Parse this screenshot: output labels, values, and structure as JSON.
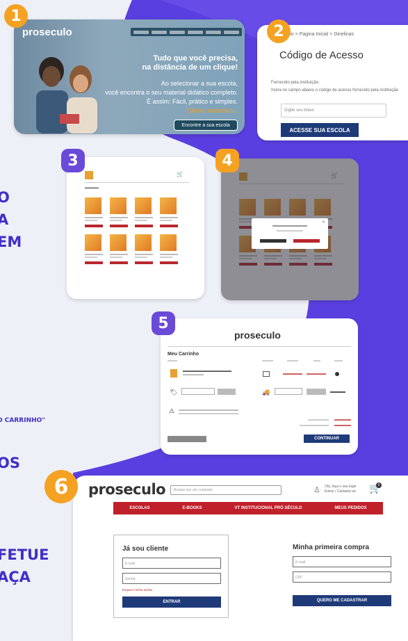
{
  "colors": {
    "purple": "#5a3fe0",
    "orange": "#f5a122",
    "navy": "#1e3a78",
    "red": "#c0202a"
  },
  "badges": [
    "1",
    "2",
    "3",
    "4",
    "5",
    "6"
  ],
  "left_text": {
    "l1": "O",
    "l2": "A",
    "l3": "EM",
    "l4": "O CARRINHO\"",
    "l5": "OS",
    "l6": "FETUE",
    "l7": "AÇA"
  },
  "hero": {
    "logo": "proseculo",
    "headline1": "Tudo que você precisa,",
    "headline2": "na distância de um clique!",
    "p1": "Ao selecionar a sua escola,",
    "p2": "você encontra o seu material didático completo.",
    "p3": "É assim: Fácil, prático e simples.",
    "p4": "Clicou, encontrou.",
    "cta": "Encontre a sua escola"
  },
  "access": {
    "breadcrumb": "Início > Pagina Inicial > Dinelinas",
    "title": "Código de Acesso",
    "line1": "Fornecido pela instituição.",
    "line2": "Insira no campo abaixo o código de acesso fornecido pela instituição",
    "placeholder": "Digite seu token",
    "button": "ACESSE SUA ESCOLA"
  },
  "cart": {
    "logo": "proseculo",
    "title": "Meu Carrinho",
    "continue": "CONTINUAR"
  },
  "login": {
    "logo": "proseculo",
    "search_placeholder": "Busque por um conteúdo",
    "user_line1": "Olá, faça o seu login",
    "user_line2": "Entrar / Cadastre-se",
    "cart_count": "0",
    "nav": [
      "ESCOLAS",
      "E-BOOKS",
      "VT INSTITUCIONAL PRÓ SÉCULO",
      "MEUS PEDIDOS"
    ],
    "client_title": "Já sou cliente",
    "email_ph": "E-mail",
    "password_ph": "Senha",
    "forgot": "Esqueci minha senha",
    "enter": "ENTRAR",
    "first_title": "Minha primeira compra",
    "email2_ph": "E-mail",
    "cpf_ph": "CPF",
    "register": "QUERO ME CADASTRAR"
  }
}
